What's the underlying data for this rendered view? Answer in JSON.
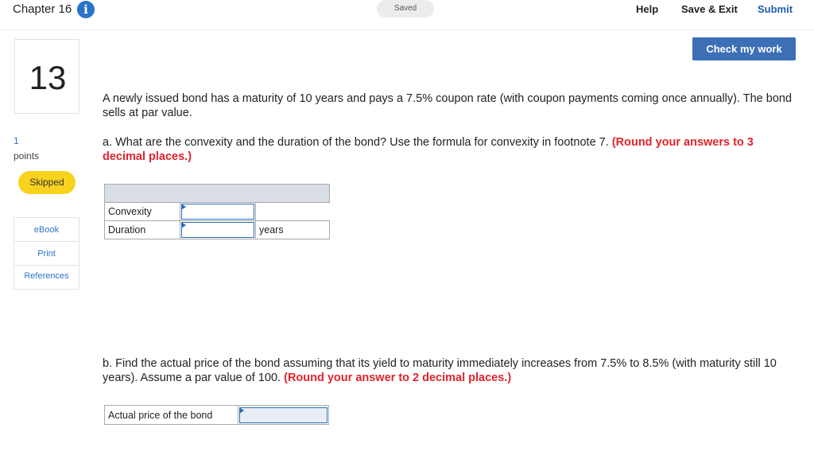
{
  "header": {
    "chapter": "Chapter 16",
    "info_icon": "i",
    "saved": "Saved",
    "help": "Help",
    "save_exit": "Save & Exit",
    "submit": "Submit"
  },
  "check_my_work": "Check my work",
  "sidebar": {
    "question_number": "13",
    "points_value": "1",
    "points_label": "points",
    "status": "Skipped",
    "tools": [
      "eBook",
      "Print",
      "References"
    ]
  },
  "question": {
    "intro": "A newly issued bond has a maturity of 10 years and pays a 7.5% coupon rate (with coupon payments coming once annually). The bond sells at par value.",
    "part_a_text": "a. What are the convexity and the duration of the bond? Use the formula for convexity in footnote 7.",
    "part_a_instruction": "(Round your answers to 3 decimal places.)",
    "table_a": {
      "rows": [
        {
          "label": "Convexity",
          "value": "",
          "unit": ""
        },
        {
          "label": "Duration",
          "value": "",
          "unit": "years"
        }
      ]
    },
    "part_b_text": "b. Find the actual price of the bond assuming that its yield to maturity immediately increases from 7.5% to 8.5% (with maturity still 10 years). Assume a par value of 100.",
    "part_b_instruction": "(Round your answer to 2 decimal places.)",
    "table_b": {
      "label": "Actual price of the bond",
      "value": ""
    }
  },
  "colors": {
    "accent_blue": "#3d6fb6",
    "link_blue": "#2b73c9",
    "warning_red": "#e0242c",
    "skipped_yellow": "#f9d21e"
  }
}
